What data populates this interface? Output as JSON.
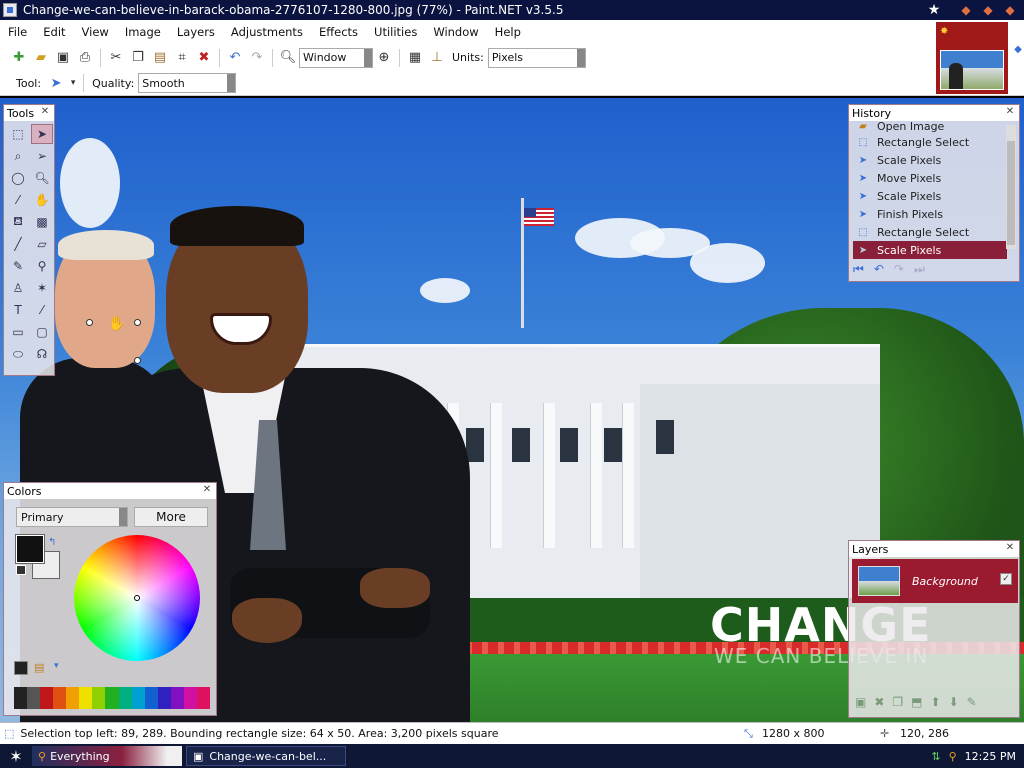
{
  "window": {
    "title": "Change-we-can-believe-in-barack-obama-2776107-1280-800.jpg (77%) - Paint.NET v3.5.5"
  },
  "menu": [
    "File",
    "Edit",
    "View",
    "Image",
    "Layers",
    "Adjustments",
    "Effects",
    "Utilities",
    "Window",
    "Help"
  ],
  "toolbar": {
    "zoom_value": "Window",
    "units_label": "Units:",
    "units_value": "Pixels",
    "tool_label": "Tool:",
    "quality_label": "Quality:",
    "quality_value": "Smooth"
  },
  "canvas": {
    "slogan_main": "CHANGE",
    "slogan_sub": "WE CAN BELIEVE IN"
  },
  "tools": {
    "title": "Tools",
    "items": [
      "rectangle-select",
      "move-selection",
      "lasso-select",
      "move-selected",
      "ellipse-select",
      "zoom",
      "magic-wand",
      "pan",
      "paint-bucket",
      "gradient",
      "paintbrush",
      "eraser",
      "pencil",
      "color-picker",
      "clone-stamp",
      "recolor",
      "text",
      "line-curve",
      "rectangle",
      "rounded-rectangle",
      "ellipse",
      "freeform-shape"
    ]
  },
  "history": {
    "title": "History",
    "items": [
      {
        "label": "Open Image",
        "icon": "open-image-icon"
      },
      {
        "label": "Rectangle Select",
        "icon": "rectangle-select-icon"
      },
      {
        "label": "Scale Pixels",
        "icon": "move-icon"
      },
      {
        "label": "Move Pixels",
        "icon": "move-icon"
      },
      {
        "label": "Scale Pixels",
        "icon": "move-icon"
      },
      {
        "label": "Finish Pixels",
        "icon": "move-icon"
      },
      {
        "label": "Rectangle Select",
        "icon": "rectangle-select-icon"
      },
      {
        "label": "Scale Pixels",
        "icon": "move-icon",
        "selected": true
      }
    ]
  },
  "colors": {
    "title": "Colors",
    "mode": "Primary",
    "more_label": "More",
    "primary": "#111111",
    "secondary": "#eeeeee",
    "palette": [
      "#222222",
      "#555555",
      "#c01818",
      "#e05010",
      "#f0a000",
      "#f0e000",
      "#90d000",
      "#20b020",
      "#00b080",
      "#00a0d0",
      "#1060d0",
      "#3020c0",
      "#8010c0",
      "#d010a0",
      "#e01060"
    ]
  },
  "layers": {
    "title": "Layers",
    "items": [
      {
        "name": "Background",
        "visible": true
      }
    ]
  },
  "status": {
    "selection_text": "Selection top left: 89, 289. Bounding rectangle size: 64 x 50. Area: 3,200 pixels square",
    "image_size": "1280 x 800",
    "cursor_pos": "120, 286"
  },
  "taskbar": {
    "task1": "Everything",
    "task2": "Change-we-can-bel...",
    "clock": "12:25 PM"
  }
}
